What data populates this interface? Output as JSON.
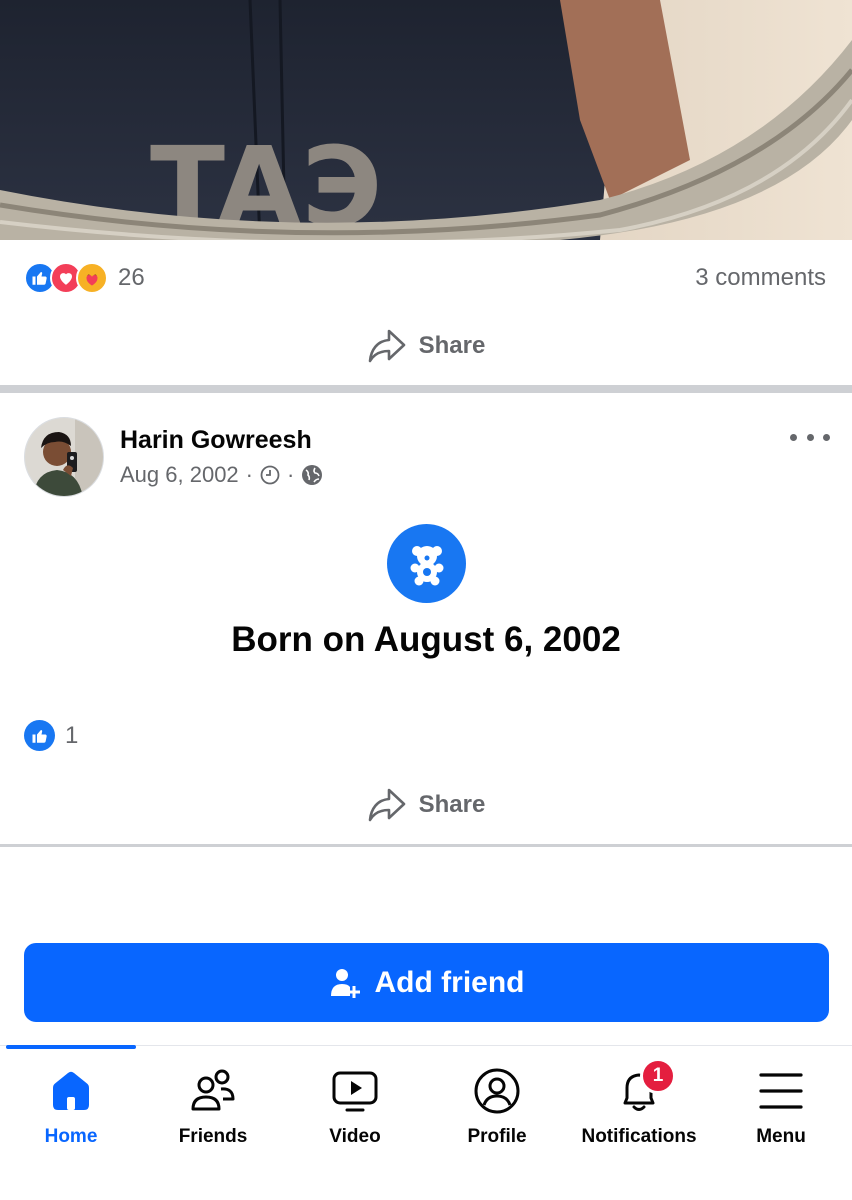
{
  "post1": {
    "reactions": {
      "icons": [
        "like-icon",
        "love-icon",
        "care-icon"
      ],
      "count": "26"
    },
    "comments": "3 comments",
    "share_label": "Share"
  },
  "post2": {
    "author": "Harin Gowreesh",
    "date": "Aug 6, 2002",
    "separator": "·",
    "life_event": "Born on August 6, 2002",
    "like_count": "1",
    "share_label": "Share"
  },
  "add_friend_label": "Add friend",
  "nav": {
    "home": "Home",
    "friends": "Friends",
    "video": "Video",
    "profile": "Profile",
    "notifications": "Notifications",
    "notifications_badge": "1",
    "menu": "Menu"
  },
  "colors": {
    "accent": "#0866ff",
    "like": "#1877f2",
    "love": "#f33e58",
    "badge": "#e41e3f"
  }
}
